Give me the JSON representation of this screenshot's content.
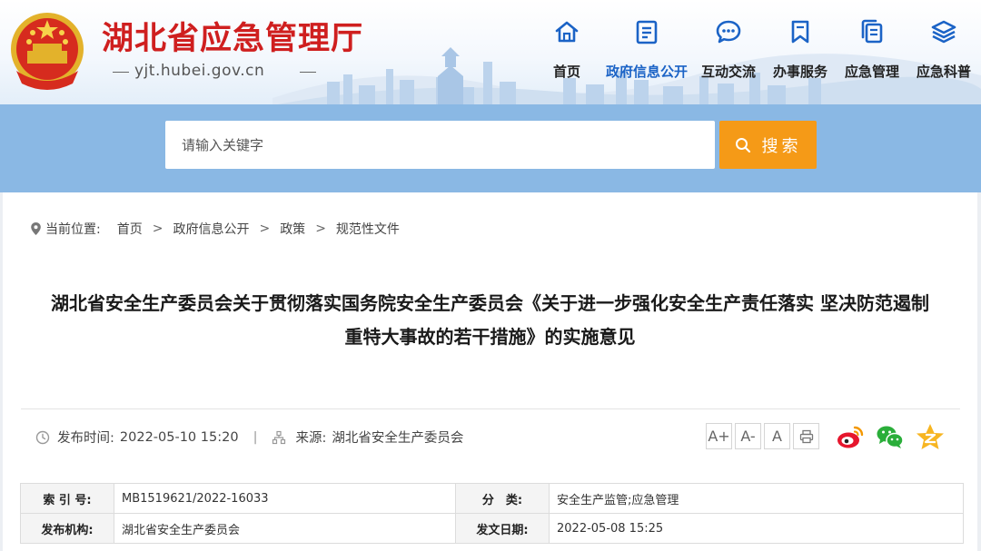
{
  "header": {
    "title": "湖北省应急管理厅",
    "domain": "yjt.hubei.gov.cn",
    "nav": [
      {
        "label": "首页",
        "icon": "home-icon"
      },
      {
        "label": "政府信息公开",
        "icon": "document-list-icon",
        "active": true
      },
      {
        "label": "互动交流",
        "icon": "chat-bubble-icon"
      },
      {
        "label": "办事服务",
        "icon": "bookmark-icon"
      },
      {
        "label": "应急管理",
        "icon": "copy-files-icon"
      },
      {
        "label": "应急科普",
        "icon": "layers-icon"
      }
    ]
  },
  "search": {
    "placeholder": "请输入关键字",
    "button_label": "搜索"
  },
  "breadcrumb": {
    "label": "当前位置:",
    "items": [
      "首页",
      "政府信息公开",
      "政策",
      "规范性文件"
    ]
  },
  "article": {
    "title_line1": "湖北省安全生产委员会关于贯彻落实国务院安全生产委员会《关于进一步强化安全生产责任落实 坚决防范遏制",
    "title_line2": "重特大事故的若干措施》的实施意见",
    "publish_label": "发布时间:",
    "publish_time": "2022-05-10 15:20",
    "source_label": "来源:",
    "source": "湖北省安全生产委员会"
  },
  "font_buttons": [
    "A+",
    "A-",
    "A"
  ],
  "info_table": [
    {
      "k1": "索 引 号:",
      "v1": "MB1519621/2022-16033",
      "k2": "分　类:",
      "v2": "安全生产监管;应急管理"
    },
    {
      "k1": "发布机构:",
      "v1": "湖北省安全生产委员会",
      "k2": "发文日期:",
      "v2": "2022-05-08 15:25"
    }
  ],
  "colors": {
    "brand_red": "#cf1f1f",
    "nav_blue": "#1b63c6",
    "search_band": "#8ab8e4",
    "search_button": "#f59a17"
  }
}
